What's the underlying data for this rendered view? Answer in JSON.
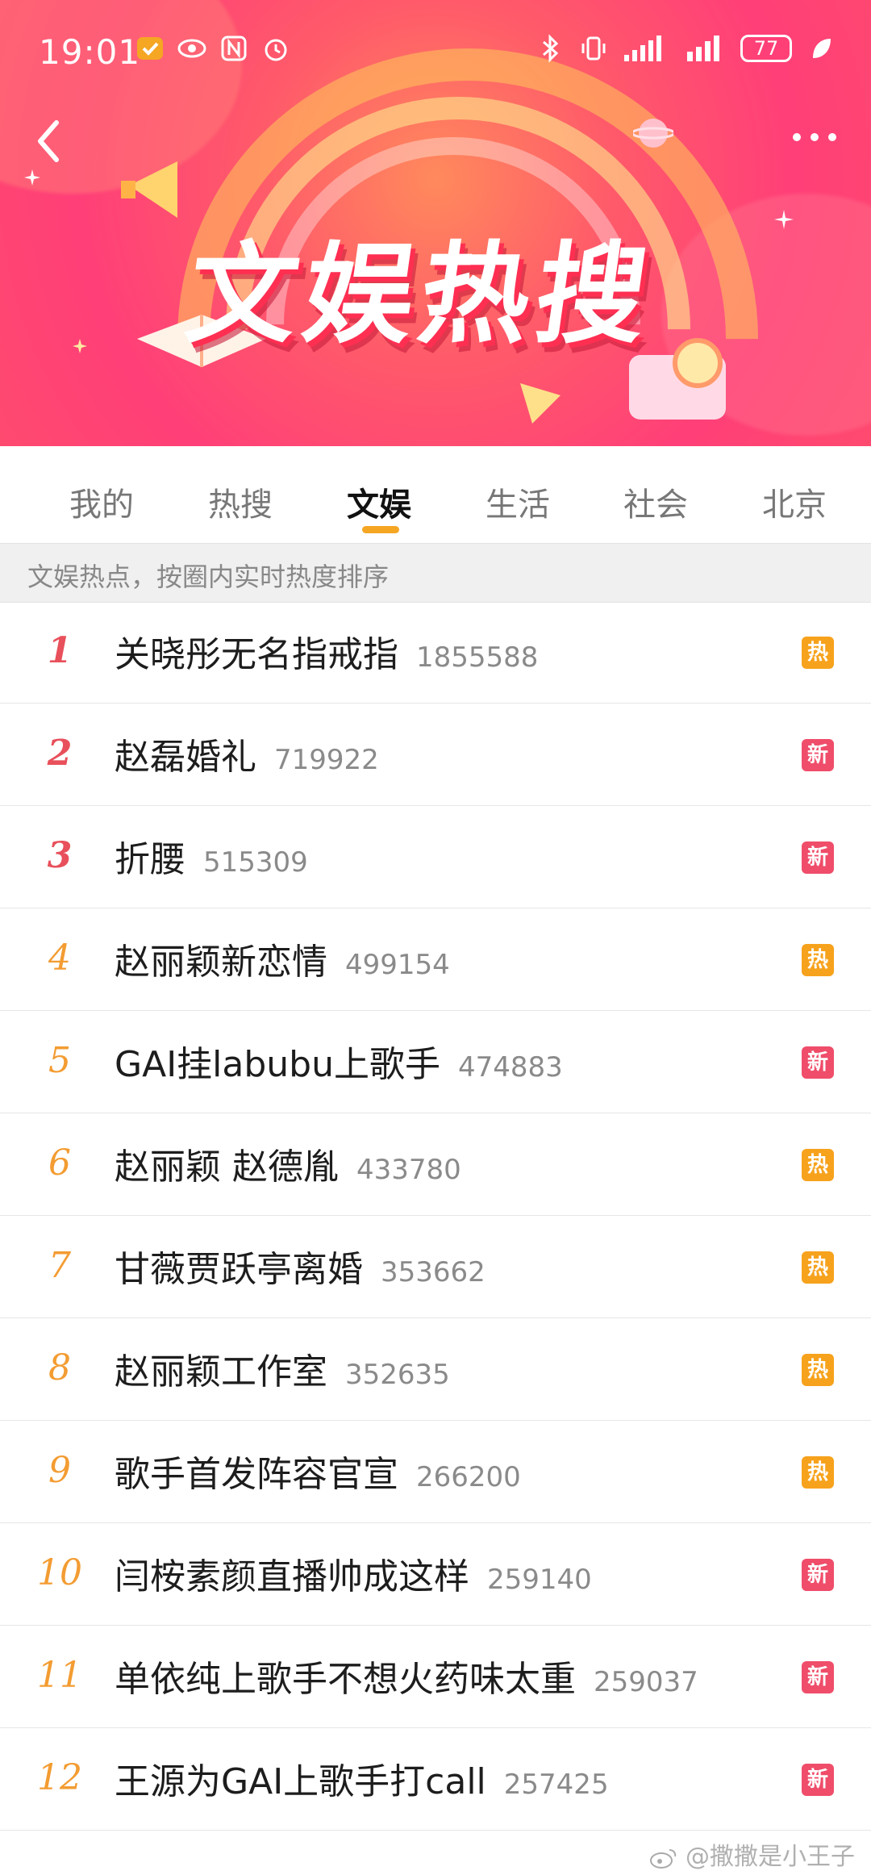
{
  "status_bar": {
    "time": "19:01",
    "battery": "77"
  },
  "banner": {
    "title": "文娱热搜"
  },
  "tabs": [
    {
      "label": "我的"
    },
    {
      "label": "热搜"
    },
    {
      "label": "文娱"
    },
    {
      "label": "生活"
    },
    {
      "label": "社会"
    },
    {
      "label": "北京"
    }
  ],
  "active_tab": "文娱",
  "subheader": "文娱热点，按圈内实时热度排序",
  "items": [
    {
      "rank": "1",
      "title": "关晓彤无名指戒指",
      "count": "1855588",
      "badge": "热"
    },
    {
      "rank": "2",
      "title": "赵磊婚礼",
      "count": "719922",
      "badge": "新"
    },
    {
      "rank": "3",
      "title": "折腰",
      "count": "515309",
      "badge": "新"
    },
    {
      "rank": "4",
      "title": "赵丽颖新恋情",
      "count": "499154",
      "badge": "热"
    },
    {
      "rank": "5",
      "title": "GAI挂labubu上歌手",
      "count": "474883",
      "badge": "新"
    },
    {
      "rank": "6",
      "title": "赵丽颖 赵德胤",
      "count": "433780",
      "badge": "热"
    },
    {
      "rank": "7",
      "title": "甘薇贾跃亭离婚",
      "count": "353662",
      "badge": "热"
    },
    {
      "rank": "8",
      "title": "赵丽颖工作室",
      "count": "352635",
      "badge": "热"
    },
    {
      "rank": "9",
      "title": "歌手首发阵容官宣",
      "count": "266200",
      "badge": "热"
    },
    {
      "rank": "10",
      "title": "闫桉素颜直播帅成这样",
      "count": "259140",
      "badge": "新"
    },
    {
      "rank": "11",
      "title": "单依纯上歌手不想火药味太重",
      "count": "259037",
      "badge": "新"
    },
    {
      "rank": "12",
      "title": "王源为GAI上歌手打call",
      "count": "257425",
      "badge": "新"
    }
  ],
  "watermark": "@撒撒是小王子",
  "colors": {
    "accent": "#f5a623",
    "hot_badge": "#f7a21c",
    "new_badge": "#ef4d6a",
    "top_rank": "#e8505b",
    "rank": "#f39c32"
  }
}
